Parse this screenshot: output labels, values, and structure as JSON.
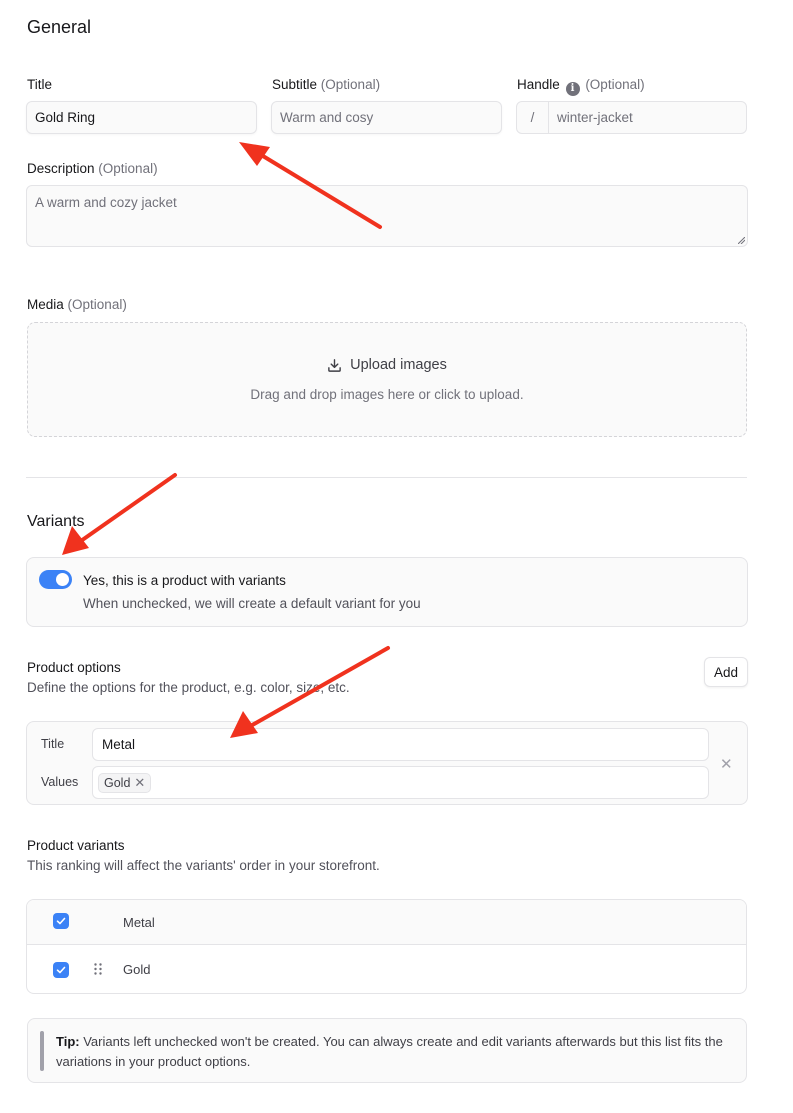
{
  "general": {
    "heading": "General",
    "title_label": "Title",
    "title_value": "Gold Ring",
    "subtitle_label": "Subtitle",
    "subtitle_optional": "(Optional)",
    "subtitle_placeholder": "Warm and cosy",
    "handle_label": "Handle",
    "handle_optional": "(Optional)",
    "handle_prefix": "/",
    "handle_placeholder": "winter-jacket",
    "description_label": "Description",
    "description_optional": "(Optional)",
    "description_placeholder": "A warm and cozy jacket"
  },
  "media": {
    "label": "Media",
    "optional": "(Optional)",
    "upload_label": "Upload images",
    "upload_hint": "Drag and drop images here or click to upload."
  },
  "variants": {
    "heading": "Variants",
    "toggle_enabled": true,
    "toggle_title": "Yes, this is a product with variants",
    "toggle_description": "When unchecked, we will create a default variant for you"
  },
  "product_options": {
    "title": "Product options",
    "description": "Define the options for the product, e.g. color, size, etc.",
    "add_button": "Add",
    "option": {
      "title_label": "Title",
      "title_value": "Metal",
      "values_label": "Values",
      "values": [
        "Gold"
      ]
    }
  },
  "product_variants": {
    "title": "Product variants",
    "description": "This ranking will affect the variants' order in your storefront.",
    "column_header": "Metal",
    "header_checked": true,
    "rows": [
      {
        "value": "Gold",
        "checked": true
      }
    ]
  },
  "tip": {
    "label": "Tip:",
    "text": "Variants left unchecked won't be created. You can always create and edit variants afterwards but this list fits the variations in your product options."
  },
  "colors": {
    "accent": "#3b82f6",
    "annotation_arrow": "#f0321e"
  }
}
